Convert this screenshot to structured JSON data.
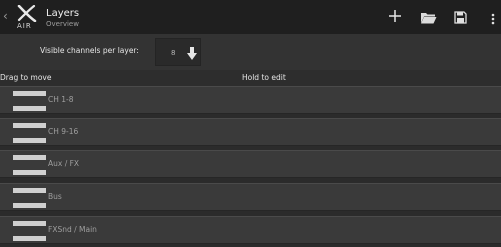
{
  "topbar": {
    "back_glyph": "‹",
    "logo_text": "AIR",
    "title": "Layers",
    "subtitle": "Overview",
    "icons": [
      "add-icon",
      "folder-open-icon",
      "save-icon",
      "more-vert-icon"
    ]
  },
  "settings": {
    "label": "Visible channels per layer:",
    "value": "8"
  },
  "header": {
    "drag_hint": "Drag to move",
    "hold_hint": "Hold to edit"
  },
  "layers": [
    {
      "label": "CH 1-8"
    },
    {
      "label": "CH 9-16"
    },
    {
      "label": "Aux / FX"
    },
    {
      "label": "Bus"
    },
    {
      "label": "FXSnd / Main"
    }
  ],
  "colors": {
    "topbar_bg": "#1f1f1f",
    "row_bg": "#3a3a3a",
    "row_text": "#9f9f9f",
    "handle": "#d0d0d0"
  }
}
